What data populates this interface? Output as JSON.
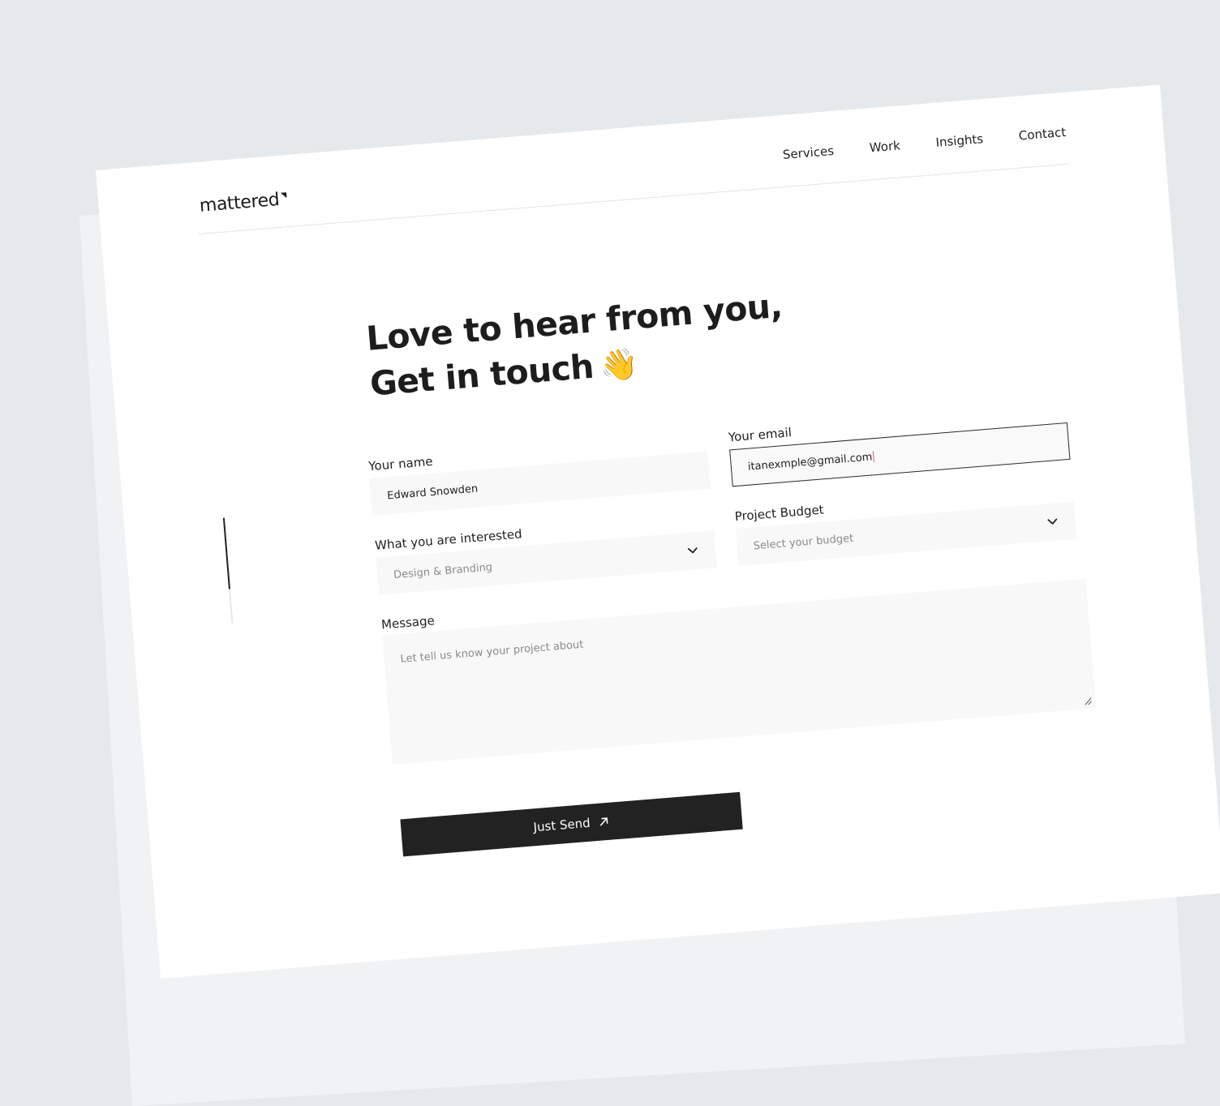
{
  "brand": {
    "logo": "mattered"
  },
  "nav": {
    "items": [
      {
        "label": "Services"
      },
      {
        "label": "Work"
      },
      {
        "label": "Insights"
      },
      {
        "label": "Contact"
      }
    ]
  },
  "hero": {
    "line1": "Love to hear from you,",
    "line2": "Get in touch",
    "emoji": "👋"
  },
  "form": {
    "name": {
      "label": "Your name",
      "value": "Edward Snowden"
    },
    "email": {
      "label": "Your email",
      "value": "itanexmple@gmail.com"
    },
    "interest": {
      "label": "What you are interested",
      "value": "Design & Branding",
      "icon": "chevron-down-icon"
    },
    "budget": {
      "label": "Project Budget",
      "placeholder": "Select your budget",
      "icon": "chevron-down-icon"
    },
    "message": {
      "label": "Message",
      "placeholder": "Let tell us know your project about"
    },
    "submit": {
      "label": "Just Send",
      "icon": "arrow-up-right-icon"
    }
  },
  "colors": {
    "background": "#e6e9ec",
    "page": "#ffffff",
    "field": "#f8f8f8",
    "button": "#222222",
    "caret": "#e05a6e"
  }
}
